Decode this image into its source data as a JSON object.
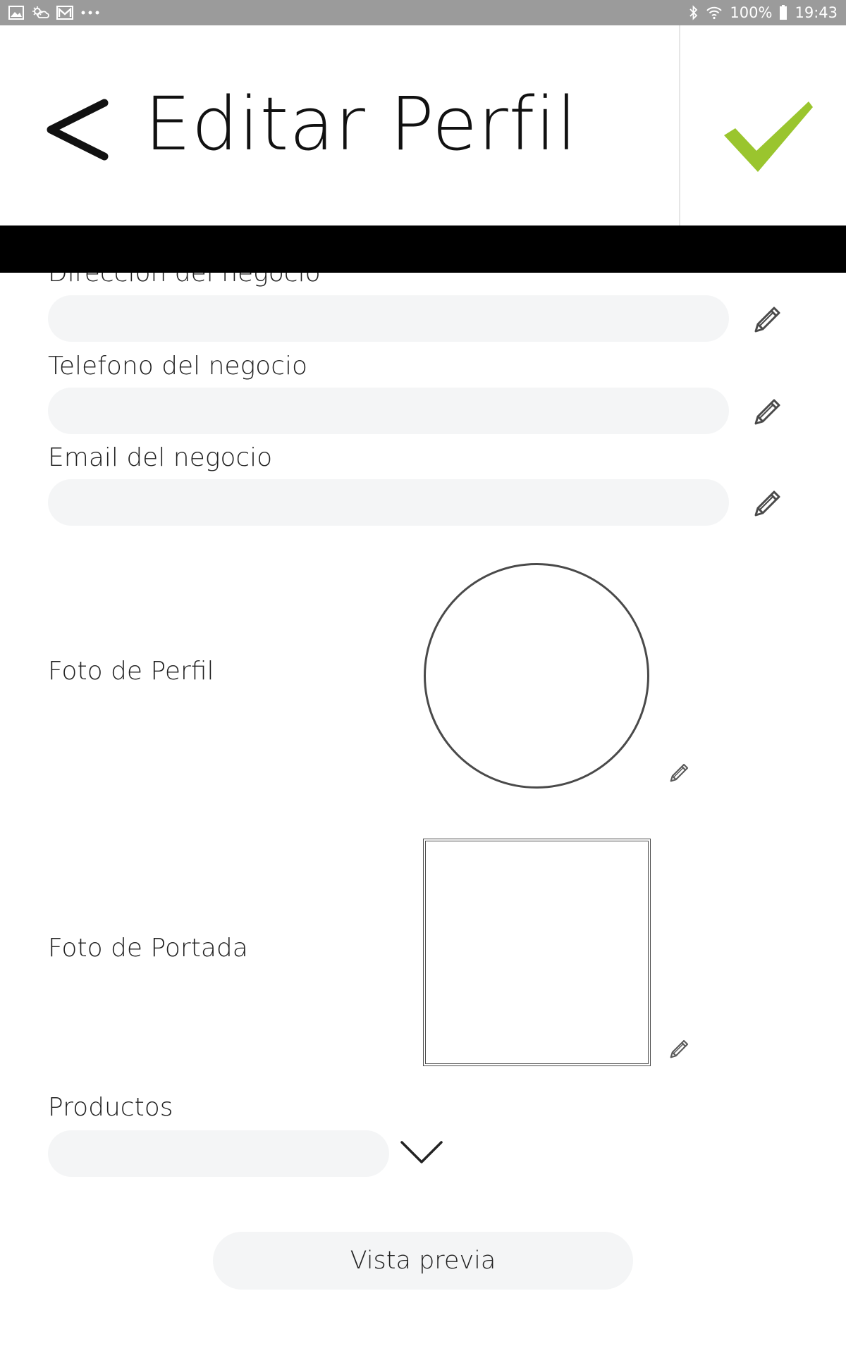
{
  "status_bar": {
    "left_icons": [
      "image-icon",
      "weather-icon",
      "mail-icon",
      "more-dots-icon"
    ],
    "battery_text": "100%",
    "time": "19:43"
  },
  "header": {
    "title": "Editar Perfil",
    "back_icon": "chevron-left-icon",
    "confirm_icon": "check-icon",
    "confirm_color": "#9ac52e"
  },
  "form": {
    "fields": [
      {
        "label": "Dirección del negocio",
        "value": "",
        "placeholder": ""
      },
      {
        "label": "Telefono del negocio",
        "value": "",
        "placeholder": ""
      },
      {
        "label": "Email del negocio",
        "value": "",
        "placeholder": ""
      }
    ],
    "profile_photo_label": "Foto de Perfil",
    "cover_photo_label": "Foto de Portada",
    "products_label": "Productos",
    "products_selected": ""
  },
  "actions": {
    "preview_label": "Vista previa"
  }
}
